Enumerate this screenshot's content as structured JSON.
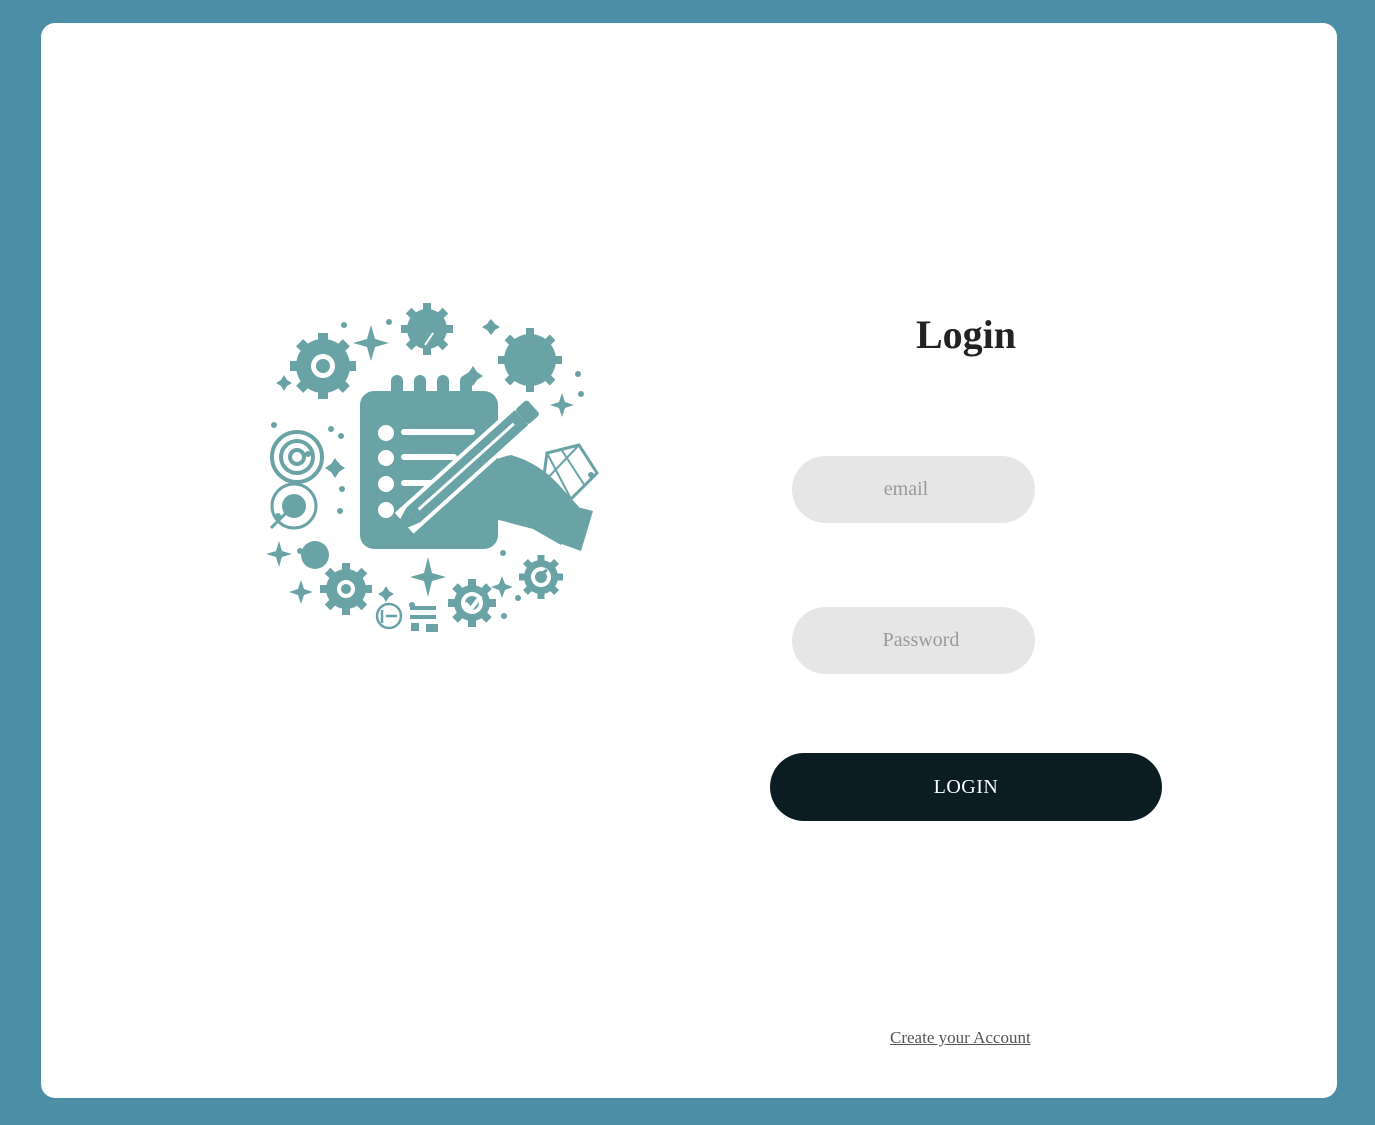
{
  "login": {
    "title": "Login",
    "email_placeholder": "email",
    "password_placeholder": "Password",
    "submit_label": "LOGIN",
    "create_account_link": "Create your Account"
  },
  "colors": {
    "page_background": "#4b8ea6",
    "card_background": "#ffffff",
    "input_background": "#e6e6e6",
    "button_background": "#0b1c23",
    "logo_color": "#6aa3a5"
  },
  "logo": {
    "icon": "notepad-pencil-gears-illustration"
  }
}
